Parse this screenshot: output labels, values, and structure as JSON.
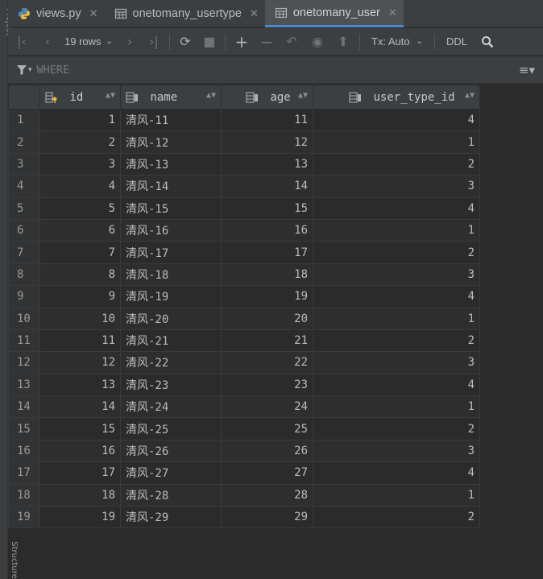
{
  "tabs": [
    {
      "label": "views.py",
      "icon": "python-file-icon",
      "active": false
    },
    {
      "label": "onetomany_usertype",
      "icon": "table-icon",
      "active": false
    },
    {
      "label": "onetomany_user",
      "icon": "table-icon",
      "active": true
    }
  ],
  "toolbar": {
    "rows_label": "19 rows",
    "tx_label": "Tx: Auto",
    "ddl_label": "DDL"
  },
  "filter": {
    "placeholder": "WHERE"
  },
  "sidebar": {
    "top_label": "Project",
    "bottom_label": "Structure"
  },
  "columns": [
    "id",
    "name",
    "age",
    "user_type_id"
  ],
  "rows": [
    {
      "n": "1",
      "id": "1",
      "name": "清风-11",
      "age": "11",
      "user_type_id": "4"
    },
    {
      "n": "2",
      "id": "2",
      "name": "清风-12",
      "age": "12",
      "user_type_id": "1"
    },
    {
      "n": "3",
      "id": "3",
      "name": "清风-13",
      "age": "13",
      "user_type_id": "2"
    },
    {
      "n": "4",
      "id": "4",
      "name": "清风-14",
      "age": "14",
      "user_type_id": "3"
    },
    {
      "n": "5",
      "id": "5",
      "name": "清风-15",
      "age": "15",
      "user_type_id": "4"
    },
    {
      "n": "6",
      "id": "6",
      "name": "清风-16",
      "age": "16",
      "user_type_id": "1"
    },
    {
      "n": "7",
      "id": "7",
      "name": "清风-17",
      "age": "17",
      "user_type_id": "2"
    },
    {
      "n": "8",
      "id": "8",
      "name": "清风-18",
      "age": "18",
      "user_type_id": "3"
    },
    {
      "n": "9",
      "id": "9",
      "name": "清风-19",
      "age": "19",
      "user_type_id": "4"
    },
    {
      "n": "10",
      "id": "10",
      "name": "清风-20",
      "age": "20",
      "user_type_id": "1"
    },
    {
      "n": "11",
      "id": "11",
      "name": "清风-21",
      "age": "21",
      "user_type_id": "2"
    },
    {
      "n": "12",
      "id": "12",
      "name": "清风-22",
      "age": "22",
      "user_type_id": "3"
    },
    {
      "n": "13",
      "id": "13",
      "name": "清风-23",
      "age": "23",
      "user_type_id": "4"
    },
    {
      "n": "14",
      "id": "14",
      "name": "清风-24",
      "age": "24",
      "user_type_id": "1"
    },
    {
      "n": "15",
      "id": "15",
      "name": "清风-25",
      "age": "25",
      "user_type_id": "2"
    },
    {
      "n": "16",
      "id": "16",
      "name": "清风-26",
      "age": "26",
      "user_type_id": "3"
    },
    {
      "n": "17",
      "id": "17",
      "name": "清风-27",
      "age": "27",
      "user_type_id": "4"
    },
    {
      "n": "18",
      "id": "18",
      "name": "清风-28",
      "age": "28",
      "user_type_id": "1"
    },
    {
      "n": "19",
      "id": "19",
      "name": "清风-29",
      "age": "29",
      "user_type_id": "2"
    }
  ]
}
